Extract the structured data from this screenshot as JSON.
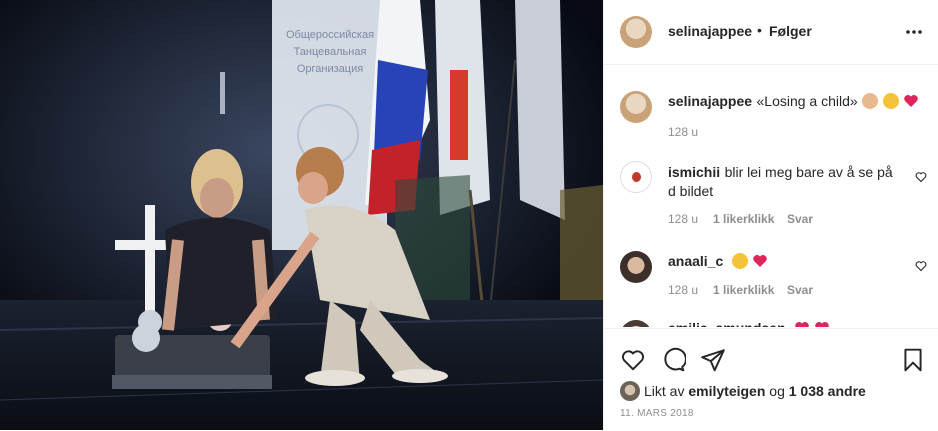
{
  "post": {
    "header": {
      "username": "selinajappee",
      "dot": "•",
      "follow_label": "Følger",
      "more_icon": "more-horizontal-icon"
    },
    "caption": {
      "username": "selinajappee",
      "text": "«Losing a child»",
      "emojis": [
        "baby-face",
        "crying-face",
        "red-heart"
      ],
      "time": "128 u"
    },
    "comments": [
      {
        "username": "ismichii",
        "text": "blir lei meg bare av å se på d bildet",
        "time": "128 u",
        "likes": "1 likerklikk",
        "reply_label": "Svar"
      },
      {
        "username": "anaali_c",
        "text": "",
        "emojis": [
          "crying-face",
          "red-heart"
        ],
        "time": "128 u",
        "likes": "1 likerklikk",
        "reply_label": "Svar"
      },
      {
        "username": "emilie_amundsen",
        "text": "",
        "emojis": [
          "red-heart",
          "red-heart"
        ]
      }
    ],
    "likes": {
      "prefix": "Likt av",
      "user": "emilyteigen",
      "joiner": "og",
      "count": "1 038 andre"
    },
    "date": "11. MARS 2018",
    "colors": {
      "heart_red": "#e0245e",
      "meta_gray": "#8e8e8e",
      "text": "#262626",
      "divider": "#efefef"
    }
  }
}
